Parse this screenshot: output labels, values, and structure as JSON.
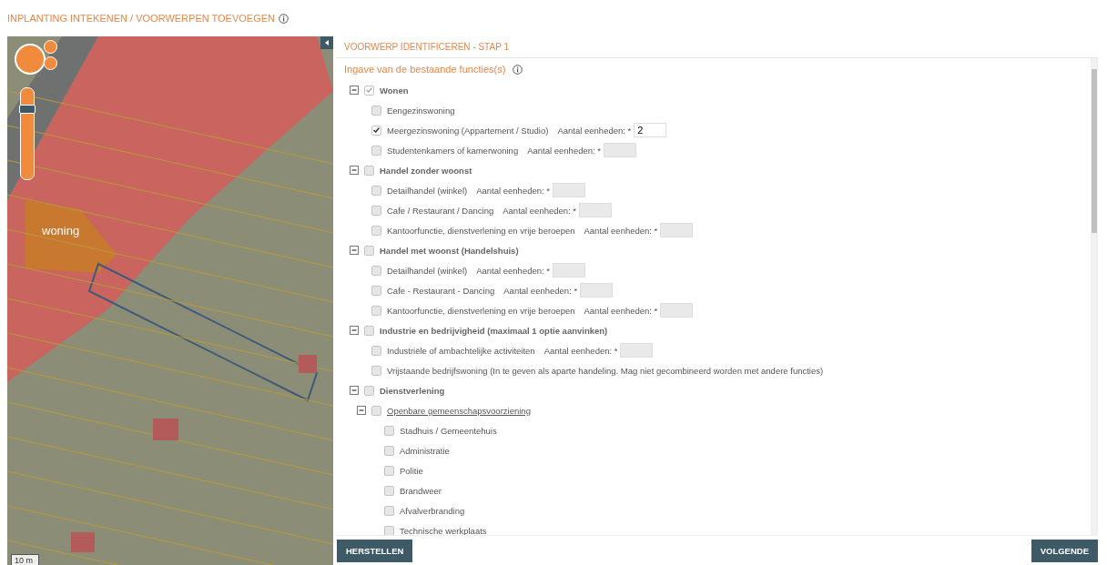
{
  "header": {
    "title": "INPLANTING INTEKENEN / VOORWERPEN TOEVOEGEN"
  },
  "map": {
    "label": "woning",
    "scale": "10 m",
    "zoom": {
      "level": 0.8
    }
  },
  "panel": {
    "step_title": "VOORWERP IDENTIFICEREN - STAP 1",
    "form_title": "Ingave van de bestaande functies(s)",
    "tree": [
      {
        "kind": "group",
        "label": "Wonen",
        "expanded": true,
        "checked": true,
        "children": [
          {
            "kind": "item",
            "label": "Eengezinswoning",
            "checked": false
          },
          {
            "kind": "item",
            "label": "Meergezinswoning (Appartement / Studio)",
            "checked": true,
            "units": {
              "label": "Aantal eenheden: *",
              "value": "2",
              "disabled": false
            }
          },
          {
            "kind": "item",
            "label": "Studentenkamers of kamerwoning",
            "checked": false,
            "units": {
              "label": "Aantal eenheden: *",
              "disabled": true
            }
          }
        ]
      },
      {
        "kind": "group",
        "label": "Handel zonder woonst",
        "expanded": true,
        "checked": false,
        "children": [
          {
            "kind": "item",
            "label": "Detailhandel (winkel)",
            "checked": false,
            "units": {
              "label": "Aantal eenheden: *",
              "disabled": true
            }
          },
          {
            "kind": "item",
            "label": "Cafe / Restaurant / Dancing",
            "checked": false,
            "units": {
              "label": "Aantal eenheden: *",
              "disabled": true
            }
          },
          {
            "kind": "item",
            "label": "Kantoorfunctie, dienstverlening en vrije beroepen",
            "checked": false,
            "units": {
              "label": "Aantal eenheden: *",
              "disabled": true
            }
          }
        ]
      },
      {
        "kind": "group",
        "label": "Handel met woonst (Handelshuis)",
        "expanded": true,
        "checked": false,
        "children": [
          {
            "kind": "item",
            "label": "Detailhandel (winkel)",
            "checked": false,
            "units": {
              "label": "Aantal eenheden: *",
              "disabled": true
            }
          },
          {
            "kind": "item",
            "label": "Cafe - Restaurant - Dancing",
            "checked": false,
            "units": {
              "label": "Aantal eenheden: *",
              "disabled": true
            }
          },
          {
            "kind": "item",
            "label": "Kantoorfunctie, dienstverlening en vrije beroepen",
            "checked": false,
            "units": {
              "label": "Aantal eenheden: *",
              "disabled": true
            }
          }
        ]
      },
      {
        "kind": "group",
        "label": "Industrie en bedrijvigheid (maximaal 1 optie aanvinken)",
        "expanded": true,
        "checked": false,
        "children": [
          {
            "kind": "item",
            "label": "Industriële of ambachtelijke activiteiten",
            "checked": false,
            "units": {
              "label": "Aantal eenheden: *",
              "disabled": true
            }
          },
          {
            "kind": "item",
            "label": "Vrijstaande bedrijfswoning (In te geven als aparte handeling. Mag niet gecombineerd worden met andere functies)",
            "checked": false
          }
        ]
      },
      {
        "kind": "group",
        "label": "Dienstverlening",
        "expanded": true,
        "checked": false,
        "children": [
          {
            "kind": "subgroup",
            "label": "Openbare gemeenschapsvoorziening",
            "expanded": true,
            "checked": false,
            "children": [
              {
                "kind": "item",
                "label": "Stadhuis / Gemeentehuis",
                "checked": false
              },
              {
                "kind": "item",
                "label": "Administratie",
                "checked": false
              },
              {
                "kind": "item",
                "label": "Politie",
                "checked": false
              },
              {
                "kind": "item",
                "label": "Brandweer",
                "checked": false
              },
              {
                "kind": "item",
                "label": "Afvalverbranding",
                "checked": false
              },
              {
                "kind": "item",
                "label": "Technische werkplaats",
                "checked": false
              }
            ]
          }
        ]
      }
    ]
  },
  "buttons": [
    {
      "label": "HERSTELLEN"
    },
    {
      "label": "VOLGENDE"
    }
  ]
}
